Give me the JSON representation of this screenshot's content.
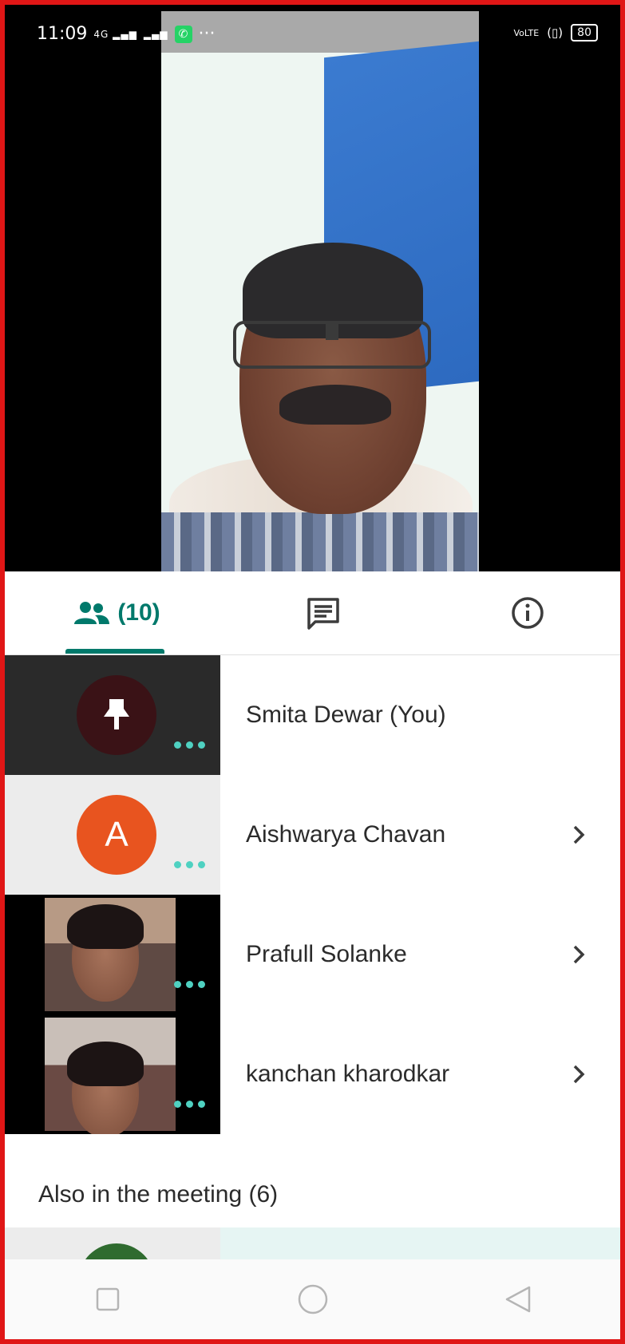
{
  "status_bar": {
    "time": "11:09",
    "network_label": "4G",
    "volte_label": "VoLTE",
    "battery": "80"
  },
  "tabs": {
    "people_count": "(10)",
    "people_icon": "people-icon",
    "chat_icon": "chat-icon",
    "info_icon": "info-icon",
    "active_color": "#00796b"
  },
  "participants": [
    {
      "name": "Smita Dewar (You)",
      "avatar": "pin-icon"
    },
    {
      "name": "Aishwarya Chavan",
      "avatar_letter": "A",
      "avatar_color": "#e8541f"
    },
    {
      "name": "Prafull Solanke",
      "avatar": "camera-feed"
    },
    {
      "name": "kanchan kharodkar",
      "avatar": "camera-feed"
    }
  ],
  "also_in_meeting": "Also in the meeting (6)",
  "navbar": {
    "recent_icon": "square-icon",
    "home_icon": "circle-icon",
    "back_icon": "triangle-back-icon"
  }
}
